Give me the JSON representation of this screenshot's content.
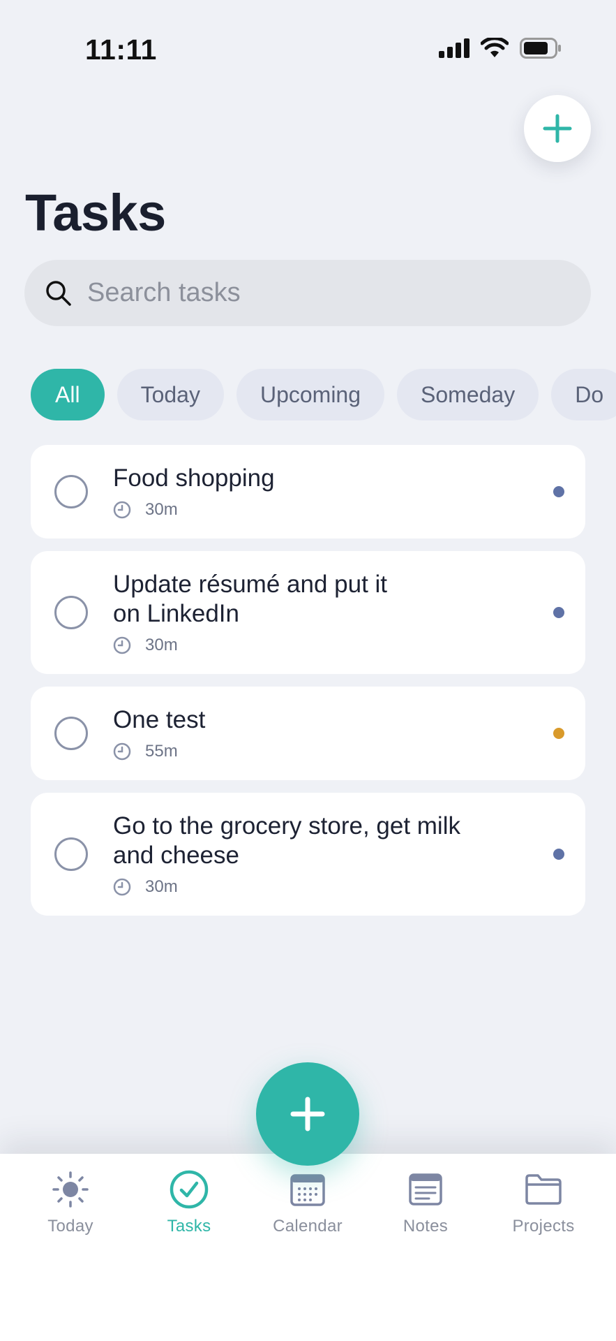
{
  "status_bar": {
    "time": "11:11"
  },
  "header": {
    "title": "Tasks"
  },
  "search": {
    "placeholder": "Search tasks"
  },
  "filters": [
    {
      "label": "All",
      "active": true
    },
    {
      "label": "Today",
      "active": false
    },
    {
      "label": "Upcoming",
      "active": false
    },
    {
      "label": "Someday",
      "active": false
    },
    {
      "label": "Do",
      "active": false
    }
  ],
  "tasks": [
    {
      "title": "Food shopping",
      "duration": "30m",
      "color": "#5f72a6"
    },
    {
      "title": "Update résumé and put it on LinkedIn",
      "duration": "30m",
      "color": "#5f72a6"
    },
    {
      "title": "One test",
      "duration": "55m",
      "color": "#d99a2b"
    },
    {
      "title": "Go to the grocery store, get milk and cheese",
      "duration": "30m",
      "color": "#5f72a6"
    }
  ],
  "tabbar": {
    "items": [
      {
        "label": "Today",
        "icon": "sun-icon"
      },
      {
        "label": "Tasks",
        "icon": "check-circle-icon"
      },
      {
        "label": "Calendar",
        "icon": "calendar-icon"
      },
      {
        "label": "Notes",
        "icon": "notes-icon"
      },
      {
        "label": "Projects",
        "icon": "folder-icon"
      }
    ]
  },
  "colors": {
    "accent": "#2fb6a8",
    "chip_bg": "#e4e7f1",
    "background": "#eff1f6"
  }
}
